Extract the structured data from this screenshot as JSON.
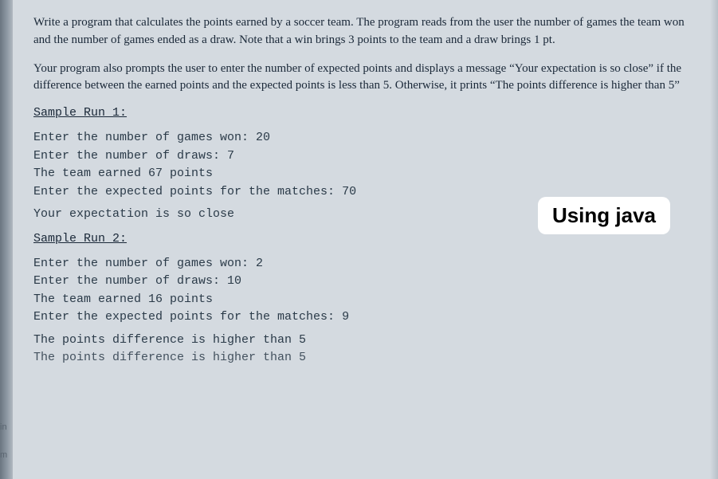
{
  "problem": {
    "paragraph1": "Write a program that calculates the points earned by a soccer team. The program reads from the user the number of games the team won and the number of games ended as a draw. Note that a win brings 3 points to the team and a draw brings 1 pt.",
    "paragraph2": "Your program also prompts the user to enter the number of expected points and displays a message “Your expectation is so close” if the difference between the earned points and the expected points is less than 5. Otherwise, it prints “The points difference is higher than 5”"
  },
  "sample1": {
    "heading": "Sample Run 1:",
    "lines": [
      "Enter the number of games won: 20",
      "Enter the number of draws: 7",
      "The team earned 67 points",
      "Enter the expected points for the matches: 70"
    ],
    "result": "Your expectation is so close"
  },
  "sample2": {
    "heading": "Sample Run 2:",
    "lines": [
      "Enter the number of games won: 2",
      "Enter the number of draws: 10",
      "The team earned 16 points",
      "Enter the expected points for the matches: 9"
    ],
    "result1": "The points difference is higher than 5",
    "result2": "The points difference is higher than 5"
  },
  "badge": "Using java",
  "markers": {
    "in": "in",
    "m": "m"
  }
}
